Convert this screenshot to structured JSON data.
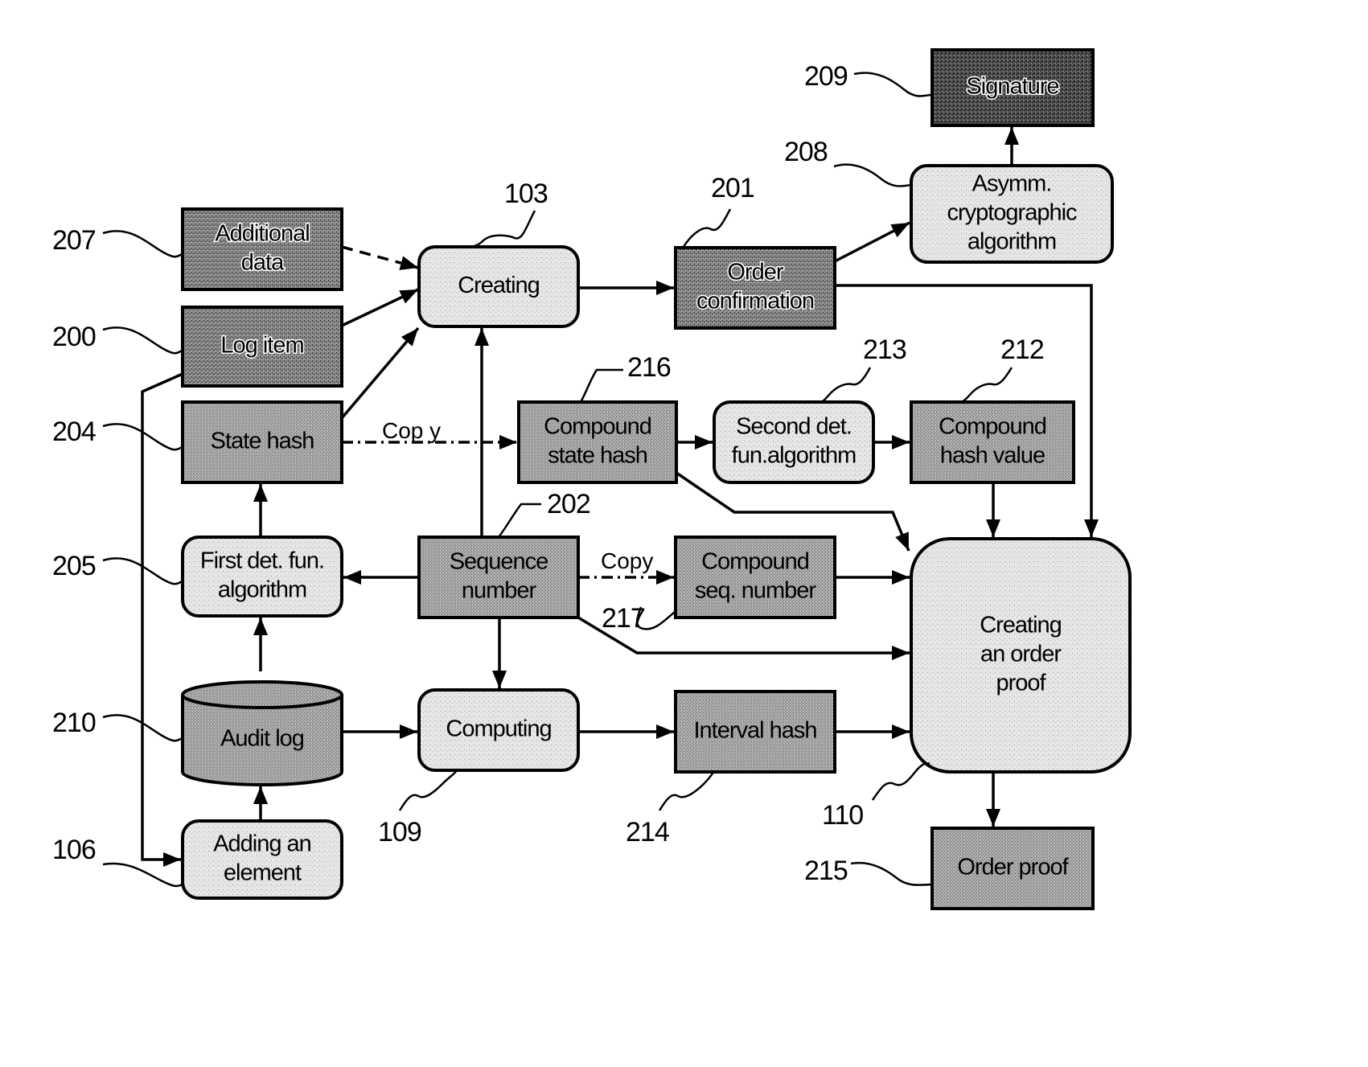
{
  "diagram": {
    "type": "flowchart",
    "nodes": [
      {
        "id": "additional-data",
        "ref": "207",
        "lines": [
          "Additional",
          "data"
        ],
        "shape": "rect",
        "tone": "dark"
      },
      {
        "id": "log-item",
        "ref": "200",
        "lines": [
          "Log item"
        ],
        "shape": "rect",
        "tone": "dark"
      },
      {
        "id": "state-hash",
        "ref": "204",
        "lines": [
          "State hash"
        ],
        "shape": "rect",
        "tone": "medium"
      },
      {
        "id": "first-det-fun-algorithm",
        "ref": "205",
        "lines": [
          "First det. fun.",
          "algorithm"
        ],
        "shape": "rounded",
        "tone": "light"
      },
      {
        "id": "audit-log",
        "ref": "210",
        "lines": [
          "Audit log"
        ],
        "shape": "cylinder",
        "tone": "medium"
      },
      {
        "id": "adding-an-element",
        "ref": "106",
        "lines": [
          "Adding an",
          "element"
        ],
        "shape": "rounded",
        "tone": "light"
      },
      {
        "id": "creating",
        "ref": "103",
        "lines": [
          "Creating"
        ],
        "shape": "rounded",
        "tone": "light"
      },
      {
        "id": "sequence-number",
        "ref": "202",
        "lines": [
          "Sequence",
          "number"
        ],
        "shape": "rect",
        "tone": "medium"
      },
      {
        "id": "computing",
        "ref": "109",
        "lines": [
          "Computing"
        ],
        "shape": "rounded",
        "tone": "light"
      },
      {
        "id": "order-confirmation",
        "ref": "201",
        "lines": [
          "Order",
          "confirmation"
        ],
        "shape": "rect",
        "tone": "dark"
      },
      {
        "id": "compound-state-hash",
        "ref": "216",
        "lines": [
          "Compound",
          "state hash"
        ],
        "shape": "rect",
        "tone": "medium"
      },
      {
        "id": "compound-seq-number",
        "ref": "217",
        "lines": [
          "Compound",
          "seq. number"
        ],
        "shape": "rect",
        "tone": "medium"
      },
      {
        "id": "interval-hash",
        "ref": "214",
        "lines": [
          "Interval hash"
        ],
        "shape": "rect",
        "tone": "medium"
      },
      {
        "id": "second-det-fun-algorithm",
        "ref": "213",
        "lines": [
          "Second det.",
          "fun.algorithm"
        ],
        "shape": "rounded",
        "tone": "light"
      },
      {
        "id": "compound-hash-value",
        "ref": "212",
        "lines": [
          "Compound",
          "hash value"
        ],
        "shape": "rect",
        "tone": "medium"
      },
      {
        "id": "asymm-cryptographic-algorithm",
        "ref": "208",
        "lines": [
          "Asymm.",
          "cryptographic",
          "algorithm"
        ],
        "shape": "rounded",
        "tone": "light"
      },
      {
        "id": "signature",
        "ref": "209",
        "lines": [
          "Signature"
        ],
        "shape": "rect",
        "tone": "darkest"
      },
      {
        "id": "creating-an-order-proof",
        "ref": "110",
        "lines": [
          "Creating",
          "an order",
          "proof"
        ],
        "shape": "rounded",
        "tone": "light"
      },
      {
        "id": "order-proof",
        "ref": "215",
        "lines": [
          "Order proof"
        ],
        "shape": "rect",
        "tone": "medium"
      }
    ],
    "edges": [
      {
        "from": "additional-data",
        "to": "creating",
        "style": "dashed"
      },
      {
        "from": "log-item",
        "to": "creating",
        "style": "solid"
      },
      {
        "from": "state-hash",
        "to": "creating",
        "style": "solid"
      },
      {
        "from": "log-item",
        "to": "adding-an-element",
        "style": "solid"
      },
      {
        "from": "first-det-fun-algorithm",
        "to": "state-hash",
        "style": "solid"
      },
      {
        "from": "audit-log",
        "to": "first-det-fun-algorithm",
        "style": "solid"
      },
      {
        "from": "adding-an-element",
        "to": "audit-log",
        "style": "solid"
      },
      {
        "from": "sequence-number",
        "to": "first-det-fun-algorithm",
        "style": "solid"
      },
      {
        "from": "sequence-number",
        "to": "creating",
        "style": "solid"
      },
      {
        "from": "sequence-number",
        "to": "computing",
        "style": "solid"
      },
      {
        "from": "audit-log",
        "to": "computing",
        "style": "solid"
      },
      {
        "from": "state-hash",
        "to": "compound-state-hash",
        "style": "dashdot",
        "label": "Cop y"
      },
      {
        "from": "sequence-number",
        "to": "compound-seq-number",
        "style": "dashdot",
        "label": "Copy"
      },
      {
        "from": "creating",
        "to": "order-confirmation",
        "style": "solid"
      },
      {
        "from": "order-confirmation",
        "to": "asymm-cryptographic-algorithm",
        "style": "solid"
      },
      {
        "from": "asymm-cryptographic-algorithm",
        "to": "signature",
        "style": "solid"
      },
      {
        "from": "order-confirmation",
        "to": "creating-an-order-proof",
        "style": "solid"
      },
      {
        "from": "compound-state-hash",
        "to": "second-det-fun-algorithm",
        "style": "solid"
      },
      {
        "from": "second-det-fun-algorithm",
        "to": "compound-hash-value",
        "style": "solid"
      },
      {
        "from": "compound-hash-value",
        "to": "creating-an-order-proof",
        "style": "solid"
      },
      {
        "from": "compound-state-hash",
        "to": "creating-an-order-proof",
        "style": "solid"
      },
      {
        "from": "compound-seq-number",
        "to": "creating-an-order-proof",
        "style": "solid"
      },
      {
        "from": "sequence-number",
        "to": "creating-an-order-proof",
        "style": "solid"
      },
      {
        "from": "computing",
        "to": "interval-hash",
        "style": "solid"
      },
      {
        "from": "interval-hash",
        "to": "creating-an-order-proof",
        "style": "solid"
      },
      {
        "from": "creating-an-order-proof",
        "to": "order-proof",
        "style": "solid"
      }
    ]
  }
}
